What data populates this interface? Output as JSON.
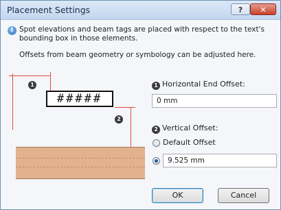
{
  "window": {
    "title": "Placement Settings",
    "help_label": "?",
    "close_label": "✕"
  },
  "info": {
    "icon": "info-icon",
    "text": "Spot elevations and beam tags are placed with respect to the text's bounding box in those elements.",
    "offsets_text": "Offsets from beam geometry or symbology can be adjusted here."
  },
  "diagram": {
    "tag_text": "#####",
    "badge_1": "1",
    "badge_2": "2",
    "accent_color": "#e14b3b",
    "beam_color": "#e2b28f"
  },
  "horizontal": {
    "badge": "1",
    "label": "Horizontal End Offset:",
    "value": "0 mm"
  },
  "vertical": {
    "badge": "2",
    "label": "Vertical Offset:",
    "default_option": "Default Offset",
    "custom_value": "9.525 mm",
    "selected": "custom"
  },
  "buttons": {
    "ok": "OK",
    "cancel": "Cancel"
  }
}
